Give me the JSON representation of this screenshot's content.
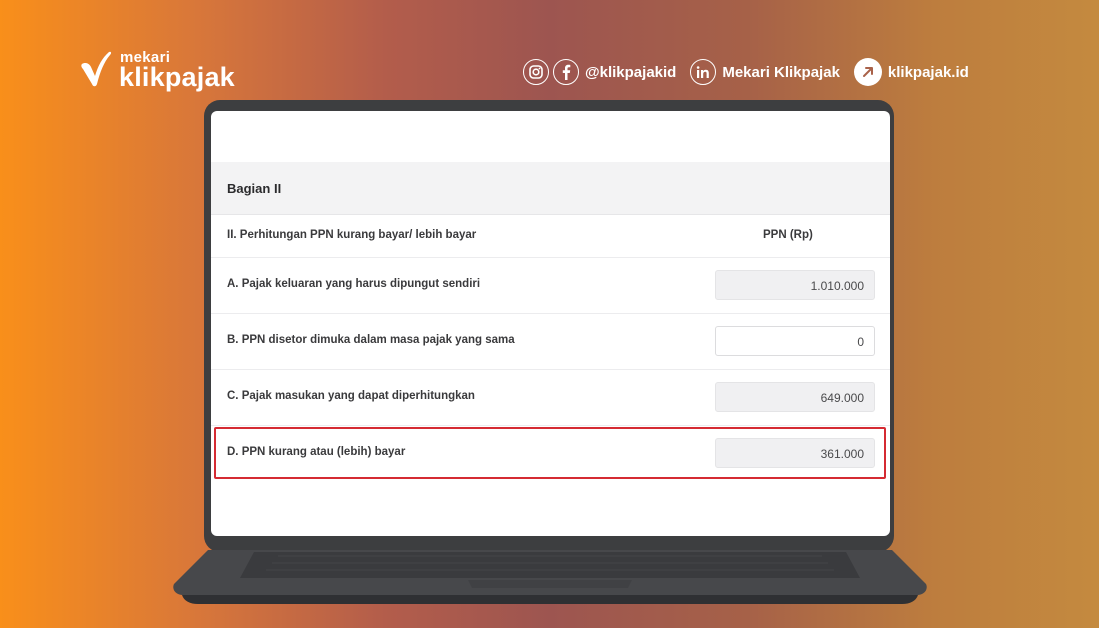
{
  "brand": {
    "small": "mekari",
    "name": "klikpajak",
    "check_icon": "check-logo-icon",
    "color": "#ffffff"
  },
  "socials": {
    "handle": "@klikpajakid",
    "linkedin": "Mekari Klikpajak",
    "website": "klikpajak.id",
    "icons": [
      "instagram-icon",
      "facebook-icon",
      "linkedin-icon",
      "arrow-up-right-icon"
    ]
  },
  "form": {
    "section_title": "Bagian II",
    "header_label": "II. Perhitungan PPN kurang bayar/ lebih bayar",
    "column_header": "PPN (Rp)",
    "rows": [
      {
        "label": "A. Pajak keluaran yang harus dipungut sendiri",
        "value": "1.010.000"
      },
      {
        "label": "B. PPN disetor dimuka dalam masa pajak yang sama",
        "value": "0"
      },
      {
        "label": "C. Pajak masukan yang dapat diperhitungkan",
        "value": "649.000"
      },
      {
        "label": "D. PPN kurang atau (lebih) bayar",
        "value": "361.000"
      }
    ]
  },
  "colors": {
    "highlight": "#d52b33",
    "laptop": "#3d3e40",
    "background_start": "#f98f1a",
    "background_mid": "#9d5550",
    "background_end": "#c48a3f"
  }
}
